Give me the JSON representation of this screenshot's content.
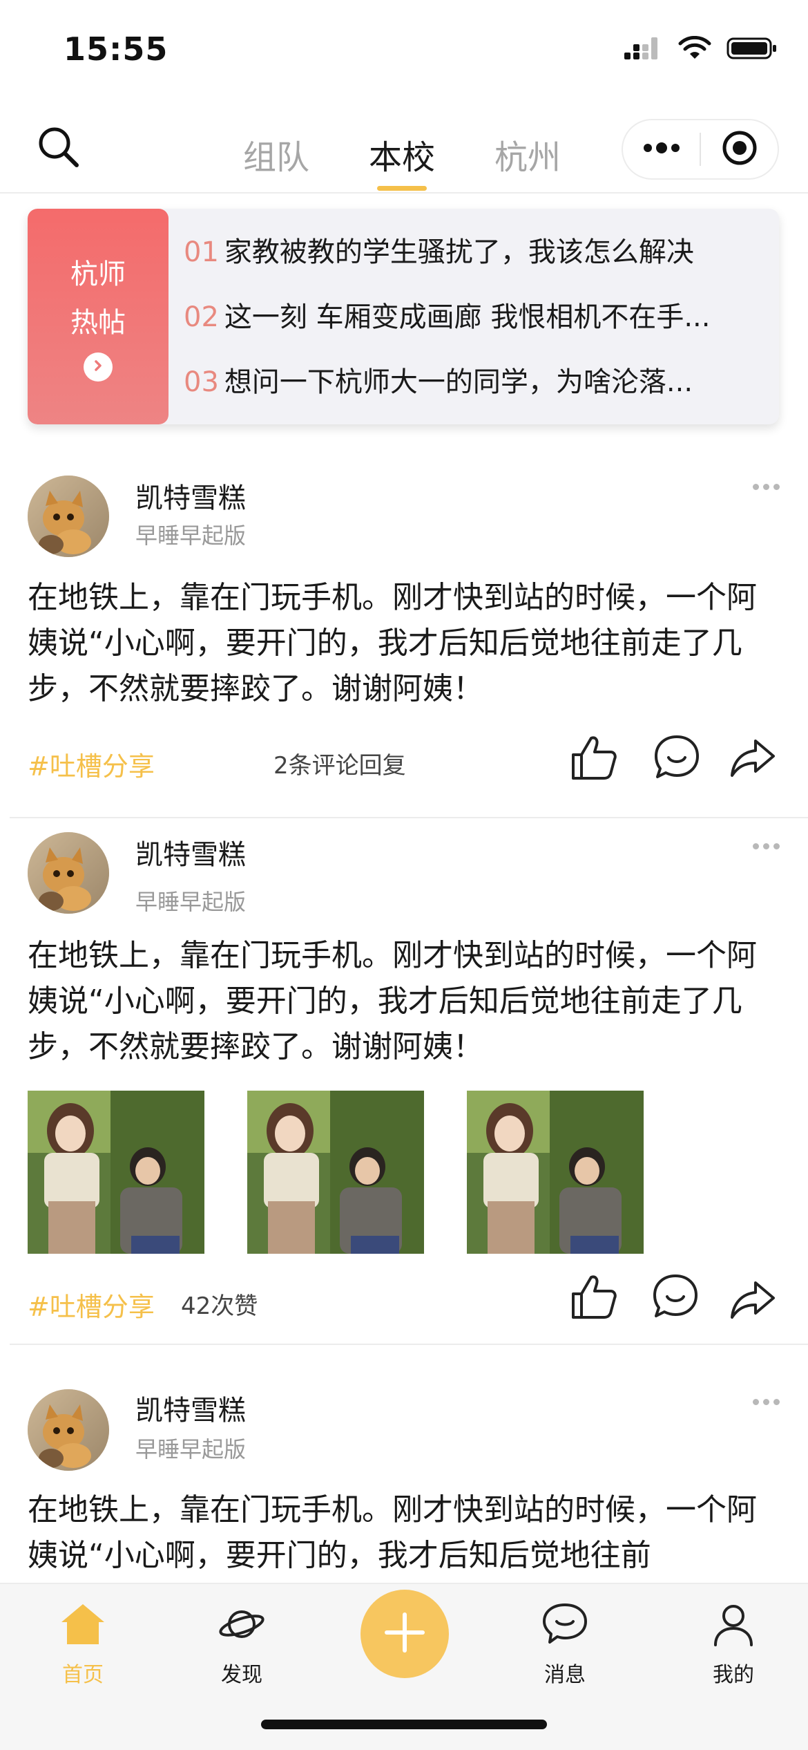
{
  "status_bar": {
    "time": "15:55"
  },
  "top_nav": {
    "tabs": [
      {
        "label": "组队",
        "active": false
      },
      {
        "label": "本校",
        "active": true
      },
      {
        "label": "杭州",
        "active": false
      }
    ],
    "accent_color": "#f5c04a"
  },
  "hot_posts": {
    "label_line1": "杭师",
    "label_line2": "热帖",
    "items": [
      {
        "num": "01",
        "text": "家教被教的学生骚扰了，我该怎么解决"
      },
      {
        "num": "02",
        "text": "这一刻 车厢变成画廊 我恨相机不在手..."
      },
      {
        "num": "03",
        "text": "想问一下杭师大一的同学，为啥沦落..."
      }
    ]
  },
  "posts": [
    {
      "username": "凯特雪糕",
      "subtitle": "早睡早起版",
      "body": "在地铁上，靠在门玩手机。刚才快到站的时候，一个阿姨说“小心啊，要开门的，我才后知后觉地往前走了几步，不然就要摔跤了。谢谢阿姨！",
      "tag": "#吐槽分享",
      "meta": "2条评论回复"
    },
    {
      "username": "凯特雪糕",
      "subtitle": "早睡早起版",
      "body": "在地铁上，靠在门玩手机。刚才快到站的时候，一个阿姨说“小心啊，要开门的，我才后知后觉地往前走了几步，不然就要摔跤了。谢谢阿姨！",
      "tag": "#吐槽分享",
      "meta": "42次赞"
    },
    {
      "username": "凯特雪糕",
      "subtitle": "早睡早起版",
      "body": "在地铁上，靠在门玩手机。刚才快到站的时候，一个阿姨说“小心啊，要开门的，我才后知后觉地往前"
    }
  ],
  "tabbar": {
    "home": "首页",
    "discover": "发现",
    "messages": "消息",
    "mine": "我的"
  }
}
